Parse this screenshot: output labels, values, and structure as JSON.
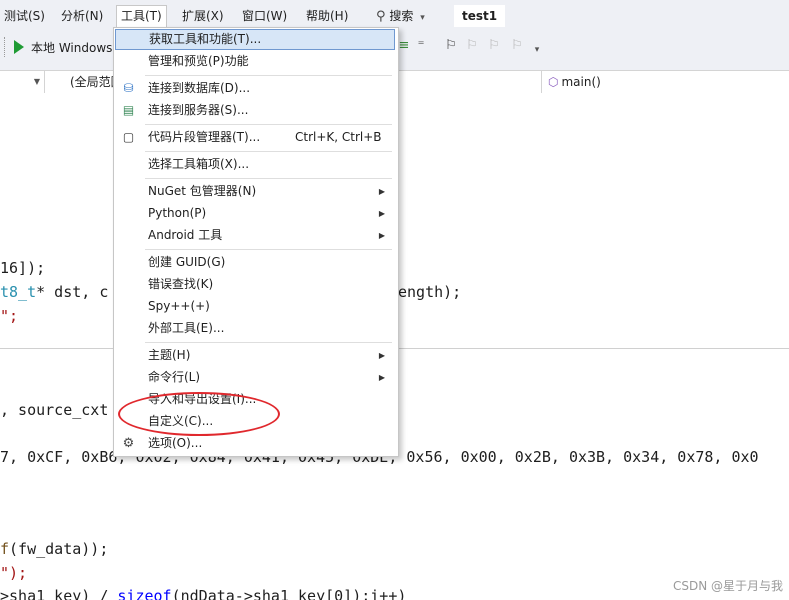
{
  "menubar": {
    "items": [
      {
        "label": "测试(S)"
      },
      {
        "label": "分析(N)"
      },
      {
        "label": "工具(T)"
      },
      {
        "label": "扩展(X)"
      },
      {
        "label": "窗口(W)"
      },
      {
        "label": "帮助(H)"
      }
    ],
    "search_label": "搜索",
    "solution_name": "test1"
  },
  "toolbar": {
    "run_label": "本地 Windows"
  },
  "navbar": {
    "scope_label": "(全局范围)",
    "function_label": "main()"
  },
  "editor": {
    "lines": [
      {
        "text": "16]);"
      },
      {
        "pre": "t8_t",
        "mid": "* dst, c",
        "post": "ength);"
      },
      {
        "str": "\";"
      },
      {
        "text": ", source_cxt"
      },
      {
        "text": "7, 0xCF, 0xB6, 0x02, 0x84, 0x41, 0x45, 0xDE, 0x56, 0x00, 0x2B, 0x3B, 0x34, 0x78, 0x0"
      },
      {
        "func": "f",
        "rest": "(fw_data));"
      },
      {
        "str": "\");"
      },
      {
        "pre": ">sha1_key) / ",
        "kw": "sizeof",
        "rest": "(ndData->sha1_key[0]);i++)"
      }
    ]
  },
  "tools_menu": {
    "items": [
      {
        "label": "获取工具和功能(T)..."
      },
      {
        "label": "管理和预览(P)功能"
      },
      {
        "label": "连接到数据库(D)..."
      },
      {
        "label": "连接到服务器(S)..."
      },
      {
        "label": "代码片段管理器(T)...",
        "shortcut": "Ctrl+K, Ctrl+B"
      },
      {
        "label": "选择工具箱项(X)..."
      },
      {
        "label": "NuGet 包管理器(N)"
      },
      {
        "label": "Python(P)"
      },
      {
        "label": "Android 工具"
      },
      {
        "label": "创建 GUID(G)"
      },
      {
        "label": "错误查找(K)"
      },
      {
        "label": "Spy++(+)"
      },
      {
        "label": "外部工具(E)..."
      },
      {
        "label": "主题(H)"
      },
      {
        "label": "命令行(L)"
      },
      {
        "label": "导入和导出设置(I)..."
      },
      {
        "label": "自定义(C)..."
      },
      {
        "label": "选项(O)..."
      }
    ]
  },
  "watermark": "CSDN @星于月与我",
  "colors": {
    "menu_highlight": "#d7e6f7",
    "annotation": "#e0282d",
    "keyword": "#0000ff",
    "type": "#2b91af",
    "string": "#a31515"
  }
}
